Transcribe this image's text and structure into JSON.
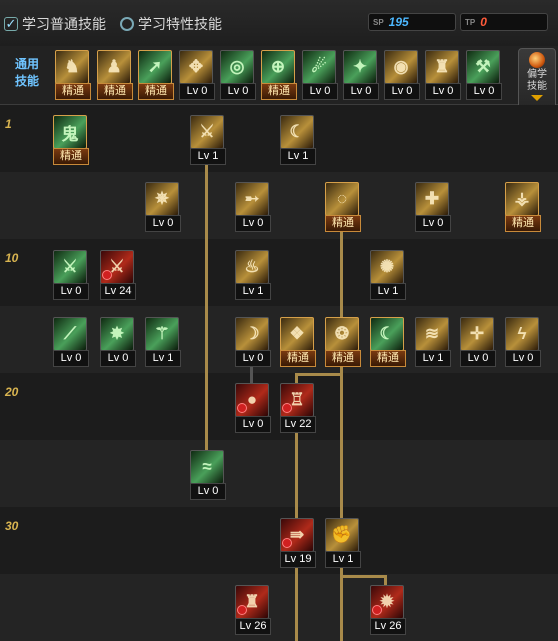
{
  "header": {
    "tab_normal": "学习普通技能",
    "tab_special": "学习特性技能",
    "sp_label": "SP",
    "sp_value": "195",
    "tp_label": "TP",
    "tp_value": "0",
    "colors": {
      "sp": "#4db8ff",
      "tp": "#ff5a3a",
      "label_blue": "#6fc4ff"
    }
  },
  "common_skills": {
    "label_line1": "通用",
    "label_line2": "技能",
    "side_button_line1": "偏学",
    "side_button_line2": "技能",
    "items": [
      {
        "level": "精通",
        "color": "gold",
        "icon": "warrior-sit-icon",
        "sym": "♞"
      },
      {
        "level": "精通",
        "color": "gold",
        "icon": "crouch-icon",
        "sym": "♟"
      },
      {
        "level": "精通",
        "color": "green",
        "icon": "sprint-icon",
        "sym": "➚"
      },
      {
        "level": "Lv 0",
        "color": "gold",
        "icon": "wing-icon",
        "sym": "✥"
      },
      {
        "level": "Lv 0",
        "color": "green",
        "icon": "target-icon",
        "sym": "◎"
      },
      {
        "level": "精通",
        "color": "green",
        "icon": "crosshair-icon",
        "sym": "⊕"
      },
      {
        "level": "Lv 0",
        "color": "green",
        "icon": "throw-icon",
        "sym": "☄"
      },
      {
        "level": "Lv 0",
        "color": "green",
        "icon": "kick-icon",
        "sym": "✦"
      },
      {
        "level": "Lv 0",
        "color": "gold",
        "icon": "eye-icon",
        "sym": "◉"
      },
      {
        "level": "Lv 0",
        "color": "gold",
        "icon": "muscle-icon",
        "sym": "♜"
      },
      {
        "level": "Lv 0",
        "color": "green",
        "icon": "strike-icon",
        "sym": "⚒"
      }
    ]
  },
  "tree": {
    "levels": [
      "1",
      "10",
      "20",
      "30"
    ],
    "skills": [
      {
        "id": "s1",
        "level": "精通",
        "color": "green",
        "icon": "ghost-icon",
        "sym": "鬼",
        "alert": false
      },
      {
        "id": "s2",
        "level": "Lv 1",
        "color": "gold",
        "icon": "slash-icon",
        "sym": "⚔",
        "alert": false
      },
      {
        "id": "s3",
        "level": "Lv 1",
        "color": "gold",
        "icon": "sweep-icon",
        "sym": "☾",
        "alert": false
      },
      {
        "id": "s4",
        "level": "Lv 0",
        "color": "gold",
        "icon": "wing-burst-icon",
        "sym": "✵",
        "alert": false
      },
      {
        "id": "s5",
        "level": "Lv 0",
        "color": "gold",
        "icon": "arrow-thrust-icon",
        "sym": "➸",
        "alert": false
      },
      {
        "id": "s6",
        "level": "精通",
        "color": "gold",
        "icon": "swirl-icon",
        "sym": "◌",
        "alert": false
      },
      {
        "id": "s7",
        "level": "Lv 0",
        "color": "gold",
        "icon": "shield-cross-icon",
        "sym": "✚",
        "alert": false
      },
      {
        "id": "s8",
        "level": "精通",
        "color": "gold",
        "icon": "triple-blade-icon",
        "sym": "⚶",
        "alert": false
      },
      {
        "id": "s9",
        "level": "Lv 0",
        "color": "green",
        "icon": "blade-green-icon",
        "sym": "⚔",
        "alert": false
      },
      {
        "id": "s10",
        "level": "Lv 24",
        "color": "red",
        "icon": "blade-red-icon",
        "sym": "⚔",
        "alert": true
      },
      {
        "id": "s11",
        "level": "Lv 1",
        "color": "gold",
        "icon": "flame-icon",
        "sym": "♨",
        "alert": false
      },
      {
        "id": "s12",
        "level": "Lv 1",
        "color": "gold",
        "icon": "vortex-icon",
        "sym": "✺",
        "alert": false
      },
      {
        "id": "s13",
        "level": "Lv 0",
        "color": "green",
        "icon": "sword-green-icon",
        "sym": "⟋",
        "alert": false
      },
      {
        "id": "s14",
        "level": "Lv 0",
        "color": "green",
        "icon": "star-burst-icon",
        "sym": "✸",
        "alert": false
      },
      {
        "id": "s15",
        "level": "Lv 1",
        "color": "green",
        "icon": "dual-blade-icon",
        "sym": "⚚",
        "alert": false
      },
      {
        "id": "s16",
        "level": "Lv 0",
        "color": "gold",
        "icon": "moon-slash-icon",
        "sym": "☽",
        "alert": false
      },
      {
        "id": "s17",
        "level": "精通",
        "color": "gold",
        "icon": "emblem-icon",
        "sym": "❖",
        "alert": false
      },
      {
        "id": "s18",
        "level": "精通",
        "color": "gold",
        "icon": "sphere-icon",
        "sym": "❂",
        "alert": false
      },
      {
        "id": "s19",
        "level": "精通",
        "color": "green",
        "icon": "crescent-icon",
        "sym": "☾",
        "alert": false
      },
      {
        "id": "s20",
        "level": "Lv 1",
        "color": "gold",
        "icon": "wind-slash-icon",
        "sym": "≋",
        "alert": false
      },
      {
        "id": "s21",
        "level": "Lv 0",
        "color": "gold",
        "icon": "cross-flash-icon",
        "sym": "✛",
        "alert": false
      },
      {
        "id": "s22",
        "level": "Lv 0",
        "color": "gold",
        "icon": "lightning-icon",
        "sym": "ϟ",
        "alert": false
      },
      {
        "id": "s23",
        "level": "Lv 0",
        "color": "red",
        "icon": "glow-orb-icon",
        "sym": "●",
        "alert": true
      },
      {
        "id": "s24",
        "level": "Lv 22",
        "color": "red",
        "icon": "totem-icon",
        "sym": "♖",
        "alert": true
      },
      {
        "id": "s25",
        "level": "Lv 0",
        "color": "green",
        "icon": "wave-icon",
        "sym": "≈",
        "alert": false
      },
      {
        "id": "s26",
        "level": "Lv 19",
        "color": "red",
        "icon": "dash-icon",
        "sym": "⇛",
        "alert": true
      },
      {
        "id": "s27",
        "level": "Lv 1",
        "color": "gold",
        "icon": "fist-icon",
        "sym": "✊",
        "alert": false
      },
      {
        "id": "s28",
        "level": "Lv 26",
        "color": "red",
        "icon": "pillar-icon",
        "sym": "♜",
        "alert": true
      },
      {
        "id": "s29",
        "level": "Lv 26",
        "color": "red",
        "icon": "explosion-icon",
        "sym": "✹",
        "alert": true
      }
    ]
  }
}
